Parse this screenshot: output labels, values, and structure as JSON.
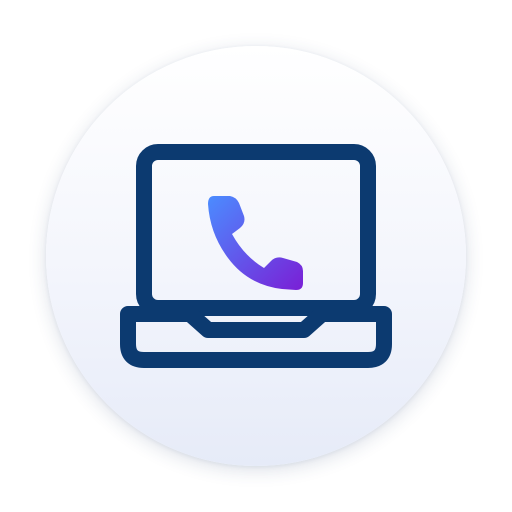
{
  "icon": {
    "name": "laptop-phone-call-icon",
    "outline_color": "#0c3a70",
    "handset_gradient": [
      "#4b8cff",
      "#7a1fd6"
    ],
    "badge_color": "#eef1fb"
  }
}
